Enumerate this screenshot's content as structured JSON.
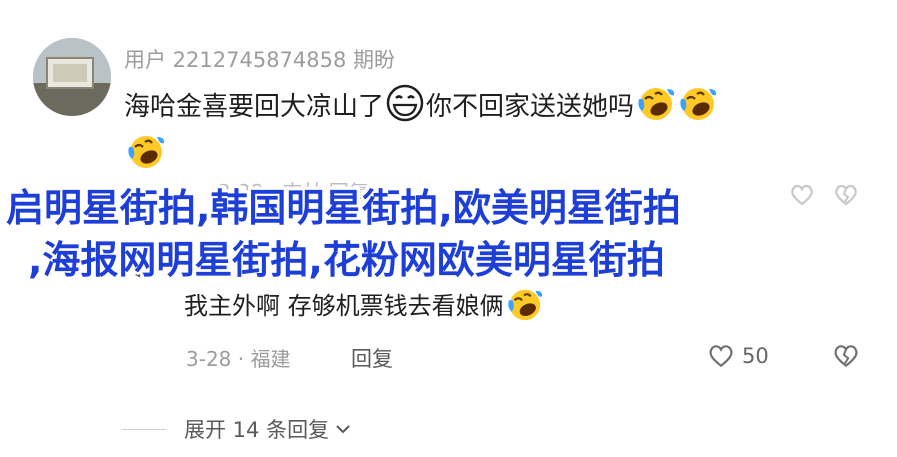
{
  "comment": {
    "username": "用户 2212745874858 期盼",
    "text_part1": "海哈金喜要回大凉山了",
    "text_part2": "你不回家送送她吗",
    "emojis": [
      "grin-emoji",
      "laugh-cry-emoji",
      "laugh-cry-emoji",
      "laugh-cry-emoji"
    ]
  },
  "faded_meta": "2-28 · 吉林   回复",
  "overlay": {
    "line1": "启明星街拍,韩国明星街拍,欧美明星街拍",
    "line2": ",海报网明星街拍,花粉网欧美明星街拍",
    "color": "#1d3fd8"
  },
  "reply": {
    "text": "我主外啊 存够机票钱去看娘俩",
    "date_location": "3-28 · 福建",
    "reply_label": "回复",
    "likes": "50"
  },
  "expand_label": "展开 14 条回复"
}
